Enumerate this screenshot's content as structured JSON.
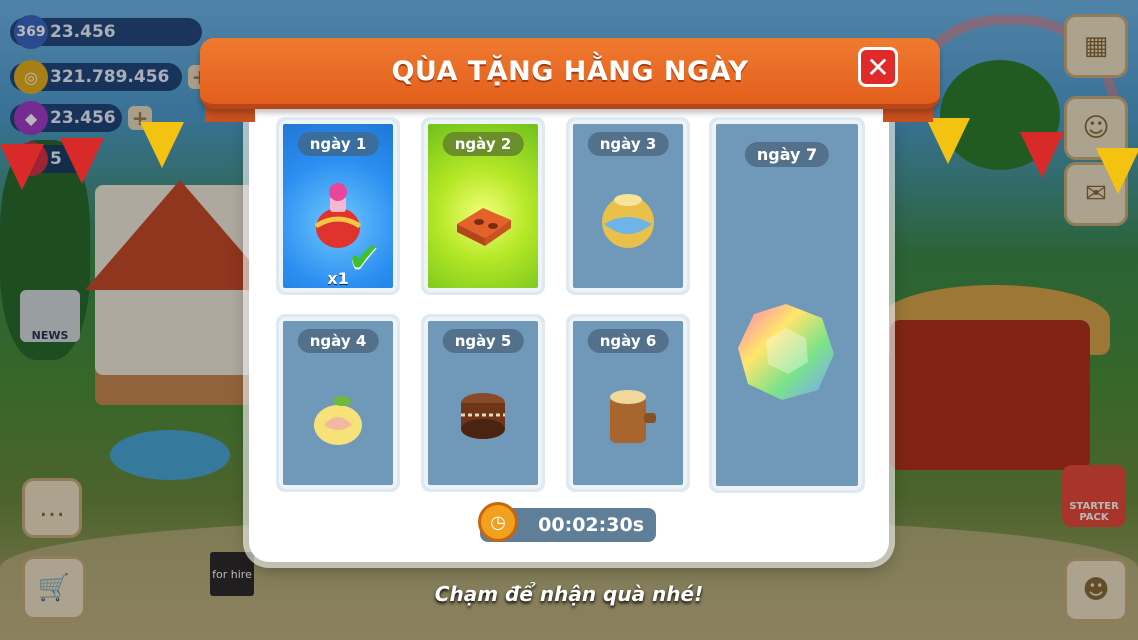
{
  "hud": {
    "level": "369",
    "xp": "23.456",
    "coins": "321.789.456",
    "gems": "23.456",
    "hearts": "5"
  },
  "modal": {
    "title": "QÙA TẶNG HẰNG NGÀY",
    "close_label": "✕",
    "days": [
      {
        "label": "ngày 1",
        "item": "potion",
        "qty": "x1",
        "state": "claimed"
      },
      {
        "label": "ngày 2",
        "item": "brick",
        "state": "today"
      },
      {
        "label": "ngày 3",
        "item": "jar"
      },
      {
        "label": "ngày 4",
        "item": "fruit"
      },
      {
        "label": "ngày 5",
        "item": "drum"
      },
      {
        "label": "ngày 6",
        "item": "log"
      },
      {
        "label": "ngày 7",
        "item": "rainbow-gem"
      }
    ],
    "timer": "00:02:30s"
  },
  "hint": "Chạm để nhận quà nhé!",
  "side": {
    "news_label": "NEWS",
    "starter_label": "STARTER PACK",
    "for_hire": "for hire"
  },
  "colors": {
    "banner": "#e9661f",
    "close": "#e02a2a",
    "card": "#6f98b9",
    "active_card": "#2a8ef0",
    "today_card": "#b6e827"
  }
}
